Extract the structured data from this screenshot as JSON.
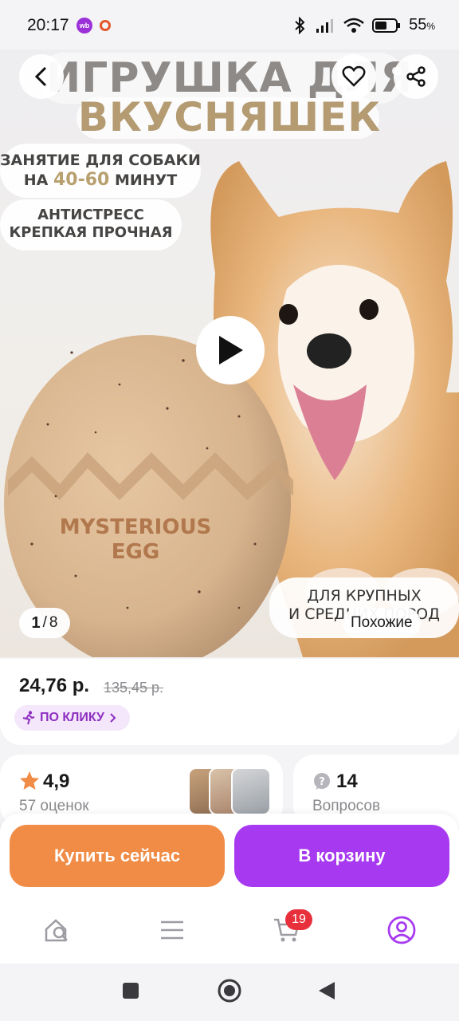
{
  "status_bar": {
    "time": "20:17",
    "wb_badge": "wb",
    "battery": "55",
    "battery_unit": "%"
  },
  "hero": {
    "title_line1": "ИГРУШКА ДЛЯ",
    "title_line2": "ВКУСНЯШЕК",
    "pill1_line1": "ЗАНЯТИЕ ДЛЯ СОБАКИ",
    "pill1_prefix": "НА",
    "pill1_highlight": "40-60",
    "pill1_suffix": "МИНУТ",
    "pill2_line1": "АНТИСТРЕСС",
    "pill2_line2": "КРЕПКАЯ  ПРОЧНАЯ",
    "pill3_line1": "ДЛЯ КРУПНЫХ",
    "pill3_line2": "И СРЕДНИХ ПОРОД",
    "egg_text_line1": "MYSTERIOUS",
    "egg_text_line2": "EGG",
    "counter_current": "1",
    "counter_sep": "/",
    "counter_total": "8",
    "similar_label": "Похожие"
  },
  "price": {
    "current": "24,76 р.",
    "old": "135,45 р.",
    "promo_label": "ПО КЛИКУ"
  },
  "rating": {
    "value": "4,9",
    "count_label": "57 оценок"
  },
  "questions": {
    "count": "14",
    "label": "Вопросов"
  },
  "actions": {
    "buy_now": "Купить сейчас",
    "add_to_cart": "В корзину"
  },
  "bottom_nav": {
    "cart_badge": "19"
  },
  "colors": {
    "buy": "#f08c46",
    "cart": "#a73af0",
    "promo_text": "#8d2fc1",
    "badge": "#e8303d",
    "star": "#f08c46"
  }
}
